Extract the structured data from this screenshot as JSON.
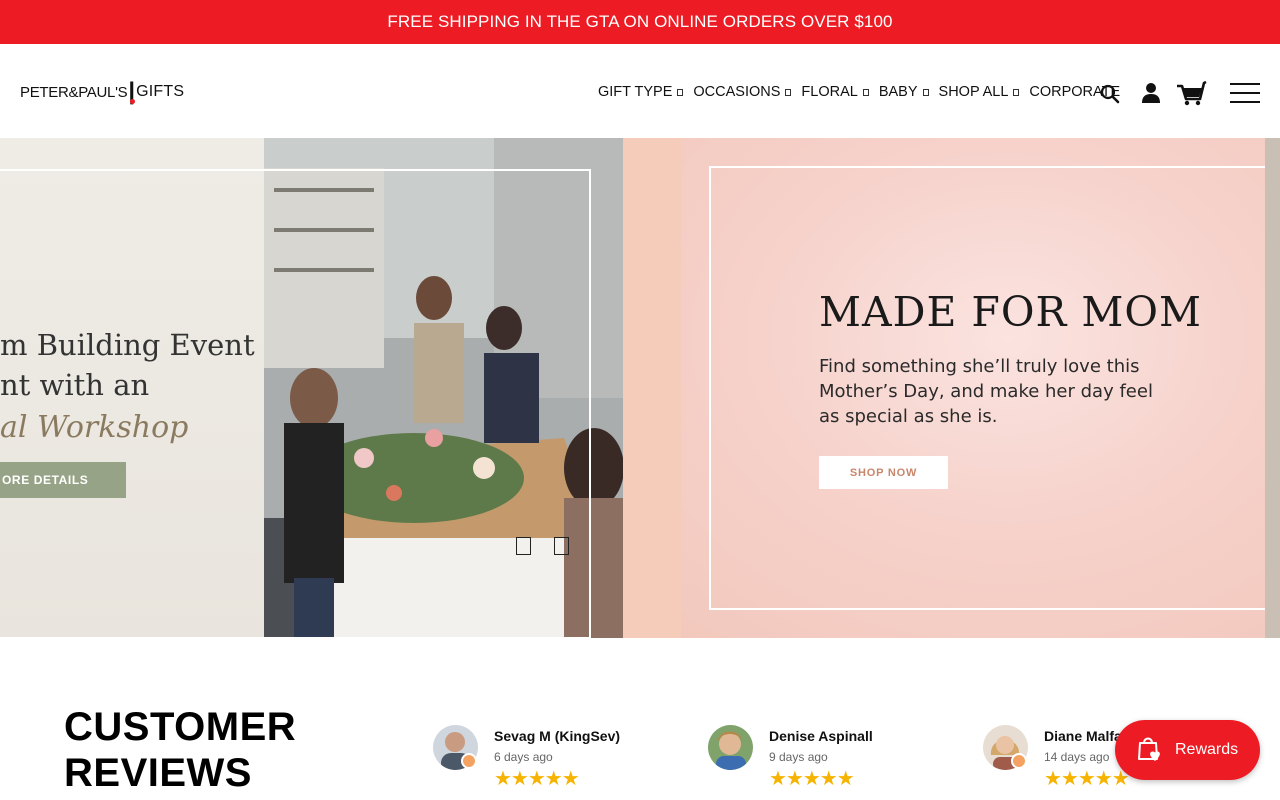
{
  "announcement": {
    "text": "FREE SHIPPING IN THE GTA ON ONLINE ORDERS OVER $100"
  },
  "brand": {
    "part1": "PETER&PAUL'S",
    "part2": "GIFTS"
  },
  "nav": {
    "items": [
      {
        "label": "GIFT TYPE",
        "dropdown": true
      },
      {
        "label": "OCCASIONS",
        "dropdown": true
      },
      {
        "label": "FLORAL",
        "dropdown": true
      },
      {
        "label": "BABY",
        "dropdown": true
      },
      {
        "label": "SHOP ALL",
        "dropdown": true
      },
      {
        "label": "CORPORATE",
        "dropdown": false
      }
    ],
    "icons": [
      "search-icon",
      "account-icon",
      "cart-icon",
      "hamburger-menu-icon"
    ]
  },
  "hero": {
    "slide_left": {
      "line1": "m Building Event",
      "line2": "nt with an",
      "line3": "al Workshop",
      "button": "ORE DETAILS"
    },
    "slide_main": {
      "heading": "MADE FOR MOM",
      "body": "Find something she’ll truly love this Mother’s Day, and make her day feel as special as she is.",
      "button": "SHOP NOW"
    }
  },
  "reviews": {
    "title_line1": "CUSTOMER",
    "title_line2": "REVIEWS",
    "items": [
      {
        "name": "Sevag M (KingSev)",
        "date": "6 days ago",
        "stars": "★★★★★",
        "rating": 5
      },
      {
        "name": "Denise Aspinall",
        "date": "9 days ago",
        "stars": "★★★★★",
        "rating": 5
      },
      {
        "name": "Diane Malfa",
        "date": "14 days ago",
        "stars": "★★★★★",
        "rating": 5
      }
    ]
  },
  "rewards": {
    "label": "Rewards"
  },
  "colors": {
    "brand_red": "#ed1c24",
    "sage_button": "#97a386",
    "star": "#f6b400"
  }
}
